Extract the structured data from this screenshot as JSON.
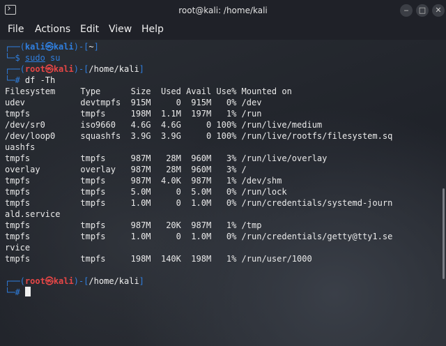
{
  "window": {
    "title": "root@kali: /home/kali"
  },
  "menu": [
    "File",
    "Actions",
    "Edit",
    "View",
    "Help"
  ],
  "prompt1": {
    "bracket_open": "┌──(",
    "user": "kali",
    "at": "㉿",
    "host": "kali",
    "mid": ")-[",
    "dir": "~",
    "bracket_close": "]",
    "dollar": "└─$ ",
    "cmd1": "sudo",
    "cmd2": " su"
  },
  "prompt2": {
    "bracket_open": "┌──(",
    "user": "root",
    "at": "㉿",
    "host": "kali",
    "mid": ")-[",
    "dir": "/home/kali",
    "bracket_close": "]",
    "hash": "└─# ",
    "cmd": "df -Th"
  },
  "output": [
    "Filesystem     Type      Size  Used Avail Use% Mounted on",
    "udev           devtmpfs  915M     0  915M   0% /dev",
    "tmpfs          tmpfs     198M  1.1M  197M   1% /run",
    "/dev/sr0       iso9660   4.6G  4.6G     0 100% /run/live/medium",
    "/dev/loop0     squashfs  3.9G  3.9G     0 100% /run/live/rootfs/filesystem.sq",
    "uashfs",
    "tmpfs          tmpfs     987M   28M  960M   3% /run/live/overlay",
    "overlay        overlay   987M   28M  960M   3% /",
    "tmpfs          tmpfs     987M  4.0K  987M   1% /dev/shm",
    "tmpfs          tmpfs     5.0M     0  5.0M   0% /run/lock",
    "tmpfs          tmpfs     1.0M     0  1.0M   0% /run/credentials/systemd-journ",
    "ald.service",
    "tmpfs          tmpfs     987M   20K  987M   1% /tmp",
    "tmpfs          tmpfs     1.0M     0  1.0M   0% /run/credentials/getty@tty1.se",
    "rvice",
    "tmpfs          tmpfs     198M  140K  198M   1% /run/user/1000"
  ],
  "prompt3": {
    "bracket_open": "┌──(",
    "user": "root",
    "at": "㉿",
    "host": "kali",
    "mid": ")-[",
    "dir": "/home/kali",
    "bracket_close": "]",
    "hash": "└─# "
  }
}
